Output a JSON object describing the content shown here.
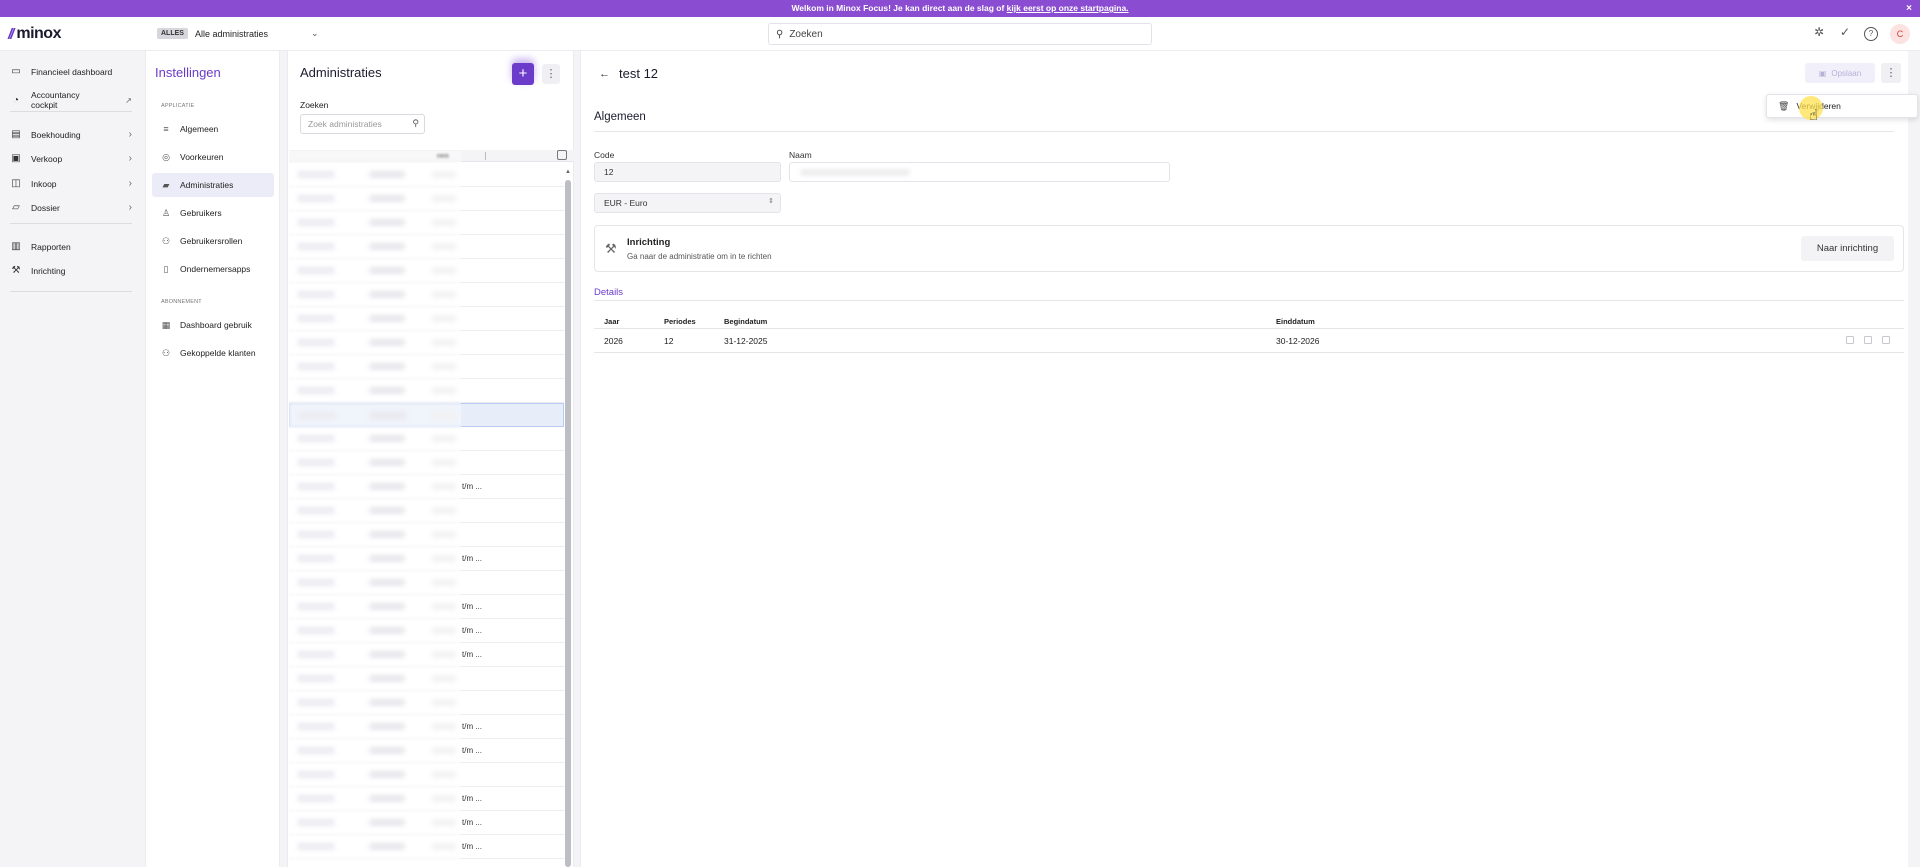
{
  "banner": {
    "text": "Welkom in Minox Focus! Je kan direct aan de slag of ",
    "link": "kijk eerst op onze startpagina.",
    "close": "×"
  },
  "topbar": {
    "logo": "minox",
    "scope_tag": "ALLES",
    "scope_value": "Alle administraties",
    "search_placeholder": "Zoeken",
    "avatar": "C"
  },
  "nav": {
    "items": [
      {
        "label": "Financieel dashboard"
      },
      {
        "label": "Accountancy cockpit"
      },
      {
        "label": "Boekhouding"
      },
      {
        "label": "Verkoop"
      },
      {
        "label": "Inkoop"
      },
      {
        "label": "Dossier"
      },
      {
        "label": "Rapporten"
      },
      {
        "label": "Inrichting"
      }
    ]
  },
  "settings": {
    "title": "Instellingen",
    "section_app": "APPLICATIE",
    "section_sub": "ABONNEMENT",
    "items": [
      {
        "label": "Algemeen"
      },
      {
        "label": "Voorkeuren"
      },
      {
        "label": "Administraties"
      },
      {
        "label": "Gebruikers"
      },
      {
        "label": "Gebruikersrollen"
      },
      {
        "label": "Ondernemersapps"
      },
      {
        "label": "Dashboard gebruik"
      },
      {
        "label": "Gekoppelde klanten"
      }
    ]
  },
  "list": {
    "title": "Administraties",
    "add": "+",
    "search_label": "Zoeken",
    "search_placeholder": "Zoek administraties",
    "col_partial": "ren",
    "row_suffix": "t/m ..."
  },
  "detail": {
    "title": "test 12",
    "save": "Opslaan",
    "section": "Algemeen",
    "code_label": "Code",
    "code_value": "12",
    "name_label": "Naam",
    "currency": "EUR - Euro",
    "setup_title": "Inrichting",
    "setup_desc": "Ga naar de administratie om in te richten",
    "setup_button": "Naar inrichting",
    "details_link": "Details",
    "table": {
      "headers": [
        "Jaar",
        "Periodes",
        "Begindatum",
        "Einddatum"
      ],
      "rows": [
        [
          "2026",
          "12",
          "31-12-2025",
          "30-12-2026"
        ]
      ]
    }
  },
  "menu": {
    "delete": "Verwijderen"
  },
  "colors": {
    "accent": "#6b3cc9",
    "banner": "#8a4cd0"
  }
}
